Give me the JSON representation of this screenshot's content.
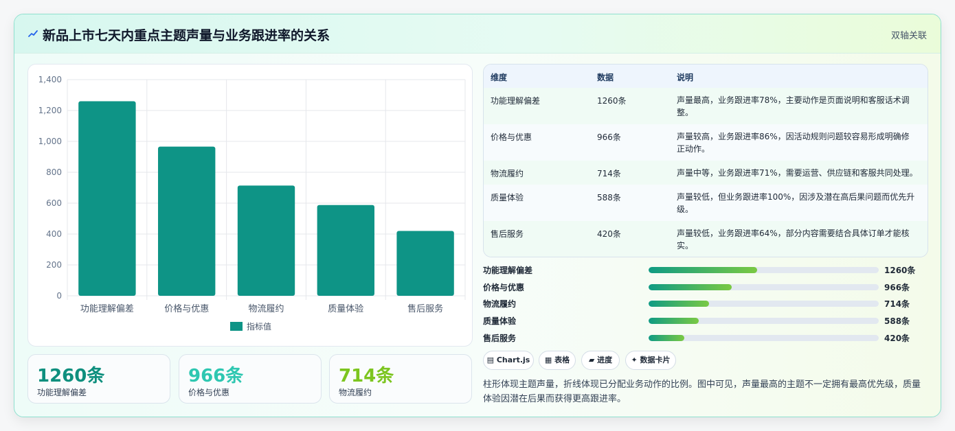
{
  "header": {
    "title": "新品上市七天内重点主题声量与业务跟进率的关系",
    "right_label": "双轴关联"
  },
  "chart_data": {
    "type": "bar",
    "categories": [
      "功能理解偏差",
      "价格与优惠",
      "物流履约",
      "质量体验",
      "售后服务"
    ],
    "series": [
      {
        "name": "指标值",
        "values": [
          1260,
          966,
          714,
          588,
          420
        ],
        "color": "#0e9486"
      }
    ],
    "ylim": [
      0,
      1400
    ],
    "yticks": [
      0,
      200,
      400,
      600,
      800,
      1000,
      1200,
      1400
    ],
    "ytick_labels": [
      "0",
      "200",
      "400",
      "600",
      "800",
      "1,000",
      "1,200",
      "1,400"
    ],
    "grid": true,
    "legend_position": "bottom"
  },
  "stats": [
    {
      "value": "1260条",
      "label": "功能理解偏差",
      "color": "#0e8f7e"
    },
    {
      "value": "966条",
      "label": "价格与优惠",
      "color": "#2ec7b1"
    },
    {
      "value": "714条",
      "label": "物流履约",
      "color": "#7cc51f"
    }
  ],
  "table": {
    "headers": [
      "维度",
      "数据",
      "说明"
    ],
    "rows": [
      {
        "dim": "功能理解偏差",
        "data": "1260条",
        "desc": "声量最高，业务跟进率78%，主要动作是页面说明和客服话术调整。"
      },
      {
        "dim": "价格与优惠",
        "data": "966条",
        "desc": "声量较高，业务跟进率86%，因活动规则问题较容易形成明确修正动作。"
      },
      {
        "dim": "物流履约",
        "data": "714条",
        "desc": "声量中等，业务跟进率71%，需要运营、供应链和客服共同处理。"
      },
      {
        "dim": "质量体验",
        "data": "588条",
        "desc": "声量较低，但业务跟进率100%，因涉及潜在高后果问题而优先升级。"
      },
      {
        "dim": "售后服务",
        "data": "420条",
        "desc": "声量较低，业务跟进率64%，部分内容需要结合具体订单才能核实。"
      }
    ]
  },
  "progress": [
    {
      "label": "功能理解偏差",
      "value": "1260条",
      "fraction": 0.472
    },
    {
      "label": "价格与优惠",
      "value": "966条",
      "fraction": 0.36
    },
    {
      "label": "物流履约",
      "value": "714条",
      "fraction": 0.263
    },
    {
      "label": "质量体验",
      "value": "588条",
      "fraction": 0.218
    },
    {
      "label": "售后服务",
      "value": "420条",
      "fraction": 0.156
    }
  ],
  "tags": [
    "▤ Chart.js",
    "▦ 表格",
    "▰ 进度",
    "✦ 数据卡片"
  ],
  "note": "柱形体现主题声量，折线体现已分配业务动作的比例。图中可见，声量最高的主题不一定拥有最高优先级，质量体验因潜在后果而获得更高跟进率。"
}
